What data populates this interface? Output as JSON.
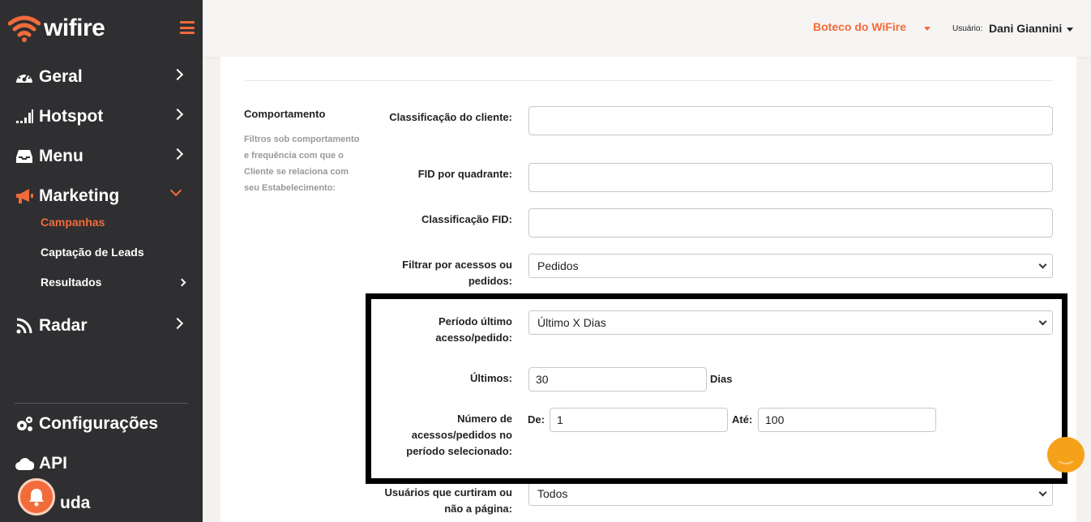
{
  "app": {
    "logo_text": "wifire"
  },
  "sidebar": {
    "items": [
      {
        "label": "Geral",
        "icon": "dashboard-icon"
      },
      {
        "label": "Hotspot",
        "icon": "signal-icon"
      },
      {
        "label": "Menu",
        "icon": "inbox-icon"
      },
      {
        "label": "Marketing",
        "icon": "megaphone-icon"
      },
      {
        "label": "Radar",
        "icon": "rss-icon"
      },
      {
        "label": "Configurações",
        "icon": "gears-icon"
      },
      {
        "label": "API",
        "icon": "cloud-icon"
      },
      {
        "label": "uda",
        "icon": "bell-icon"
      }
    ],
    "marketing_sub": [
      {
        "label": "Campanhas",
        "active": true
      },
      {
        "label": "Captação de Leads"
      },
      {
        "label": "Resultados"
      }
    ]
  },
  "topbar": {
    "store": "Boteco do WiFire",
    "user_label": "Usuário:",
    "user_name": "Dani Giannini"
  },
  "section": {
    "title": "Comportamento",
    "description": "Filtros sob comportamento e frequência com que o Cliente se relaciona com seu Estabelecimento:"
  },
  "form": {
    "classificacao_cliente_label": "Classificação do cliente:",
    "classificacao_cliente_value": "",
    "fid_quadrante_label": "FID por quadrante:",
    "fid_quadrante_value": "",
    "classificacao_fid_label": "Classificação FID:",
    "classificacao_fid_value": "",
    "filtrar_label": "Filtrar por acessos ou pedidos:",
    "filtrar_value": "Pedidos",
    "periodo_label": "Período último acesso/pedido:",
    "periodo_value": "Último X Dias",
    "ultimos_label": "Últimos:",
    "ultimos_value": "30",
    "ultimos_unit": "Dias",
    "numero_label": "Número de acessos/pedidos no período selecionado:",
    "de_label": "De:",
    "de_value": "1",
    "ate_label": "Até:",
    "ate_value": "100",
    "curtiram_label": "Usuários que curtiram ou não a página:",
    "curtiram_value": "Todos"
  },
  "colors": {
    "accent": "#f26b3a",
    "sidebar_bg": "#2f2f31",
    "chat": "#f5a11a"
  }
}
